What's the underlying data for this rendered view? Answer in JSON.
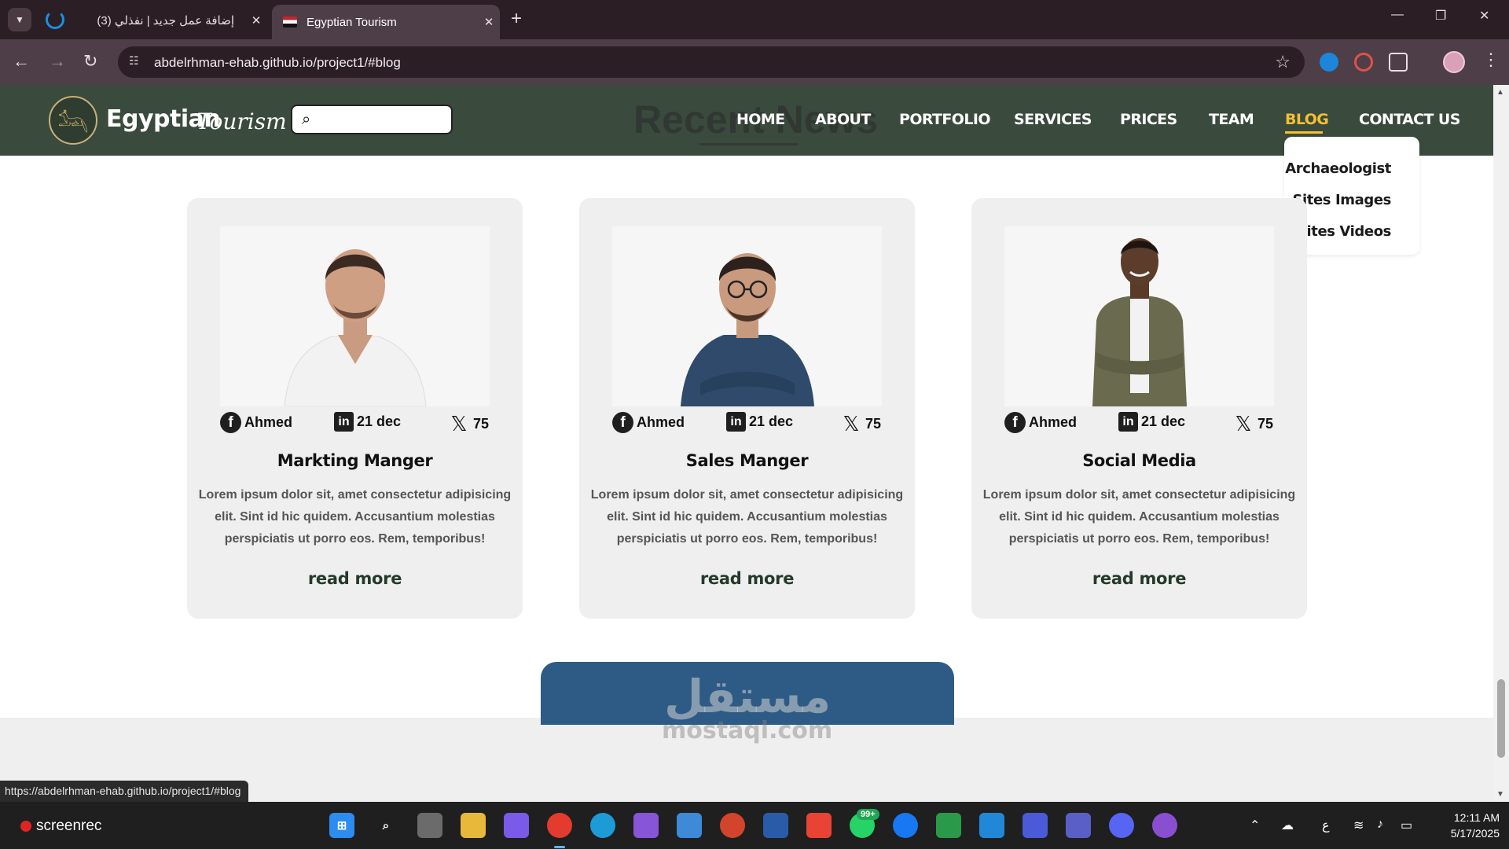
{
  "browser": {
    "tabs": [
      {
        "title": "(3) إضافة عمل جديد | نفذلي",
        "active": false
      },
      {
        "title": "Egyptian Tourism",
        "active": true
      }
    ],
    "new_tab_icon": "plus-icon",
    "address": "abdelrhman-ehab.github.io/project1/#blog",
    "status_url": "https://abdelrhman-ehab.github.io/project1/#blog"
  },
  "site": {
    "logo_main": "Egyptian",
    "logo_script": "Tourism",
    "search_placeholder": "",
    "ghost_heading": "Recent News",
    "nav": [
      "HOME",
      "ABOUT",
      "PORTFOLIO",
      "SERVICES",
      "PRICES",
      "TEAM",
      "BLOG",
      "CONTACT US"
    ],
    "active_nav": "BLOG",
    "dropdown": [
      "Archaeologist",
      "Sites Images",
      "Sites Videos"
    ],
    "colors": {
      "header": "#3a4a3d",
      "accent": "#f3c12f",
      "card": "#efefef",
      "read_more": "#243a2b"
    }
  },
  "cards": [
    {
      "author": "Ahmed",
      "date": "21 dec",
      "count": "75",
      "title": "Markting Manger",
      "body": "Lorem ipsum dolor sit, amet consectetur adipisicing elit. Sint id hic quidem. Accusantium molestias perspiciatis ut porro eos. Rem, temporibus!",
      "link": "read more"
    },
    {
      "author": "Ahmed",
      "date": "21 dec",
      "count": "75",
      "title": "Sales Manger",
      "body": "Lorem ipsum dolor sit, amet consectetur adipisicing elit. Sint id hic quidem. Accusantium molestias perspiciatis ut porro eos. Rem, temporibus!",
      "link": "read more"
    },
    {
      "author": "Ahmed",
      "date": "21 dec",
      "count": "75",
      "title": "Social Media",
      "body": "Lorem ipsum dolor sit, amet consectetur adipisicing elit. Sint id hic quidem. Accusantium molestias perspiciatis ut porro eos. Rem, temporibus!",
      "link": "read more"
    }
  ],
  "watermark": {
    "arabic": "مستقل",
    "latin": "mostaql.com"
  },
  "taskbar": {
    "recorder": "screenrec",
    "whatsapp_badge": "99+",
    "clock_time": "12:11 AM",
    "clock_date": "5/17/2025",
    "lang": "ع"
  }
}
